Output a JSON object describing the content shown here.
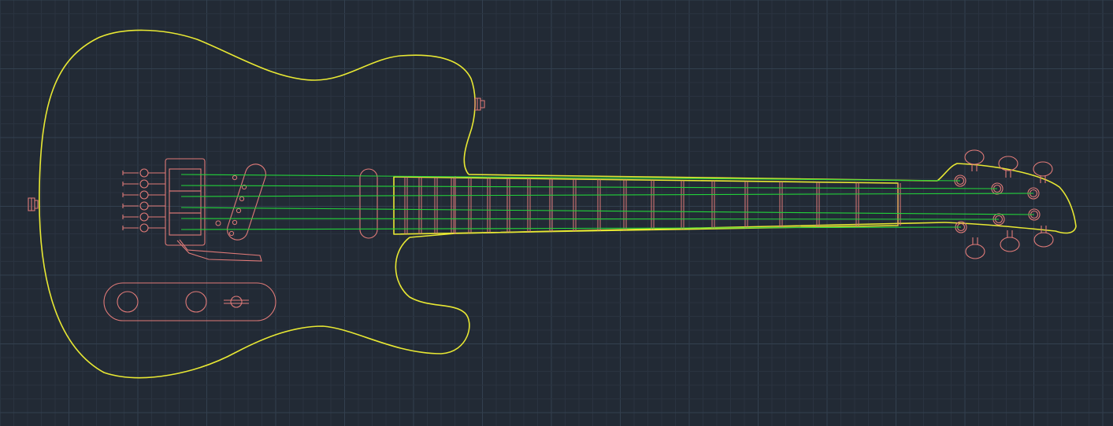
{
  "canvas": {
    "background": "#222a35",
    "grid_minor_color": "#2a3340",
    "grid_major_color": "#33404f"
  },
  "layers": {
    "body_outline": "#e8e833",
    "hardware": "#e07a78",
    "strings": "#22d33a"
  },
  "drawing": {
    "subject": "electric-guitar",
    "string_count": 6,
    "fret_count": 22,
    "tuner_count": 6,
    "control_knob_count": 2,
    "strap_button_count": 2
  }
}
